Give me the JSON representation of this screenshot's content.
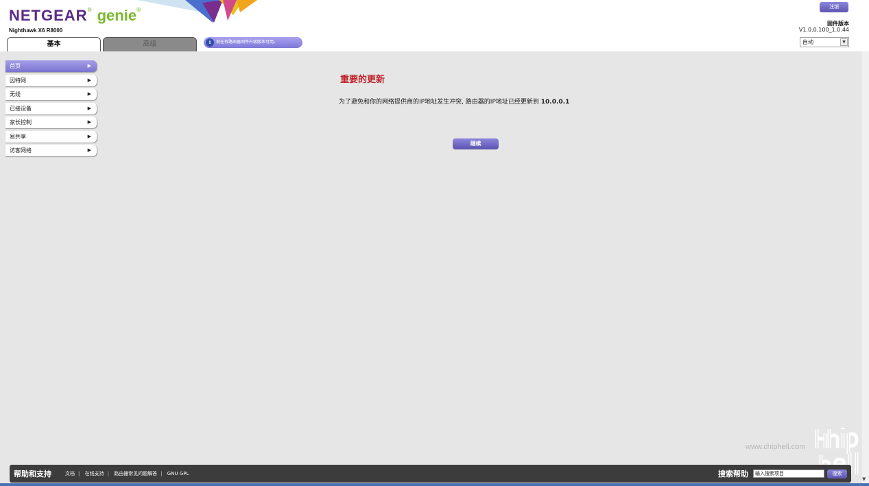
{
  "header": {
    "logo_netgear": "NETGEAR",
    "logo_genie": "genie",
    "model": "Nighthawk X6 R8000",
    "logout_label": "注销",
    "firmware_label": "固件版本",
    "firmware_version": "V1.0.0.100_1.0.44",
    "language_value": "自动",
    "info_message": "现在有路由器固件升级版本可用。",
    "brand_colors": {
      "purple": "#5b2a86",
      "green": "#7cb82f",
      "accent": "#7b74cf"
    }
  },
  "tabs": [
    {
      "label": "基本",
      "active": true
    },
    {
      "label": "高级",
      "active": false
    }
  ],
  "sidebar": {
    "items": [
      {
        "label": "首页",
        "active": true
      },
      {
        "label": "因特网",
        "active": false
      },
      {
        "label": "无线",
        "active": false
      },
      {
        "label": "已接设备",
        "active": false
      },
      {
        "label": "家长控制",
        "active": false
      },
      {
        "label": "易共享",
        "active": false
      },
      {
        "label": "访客网络",
        "active": false
      }
    ]
  },
  "main": {
    "title": "重要的更新",
    "message": "为了避免和你的网络提供商的IP地址发生冲突, 路由器的IP地址已经更新到",
    "new_ip": "10.0.0.1",
    "continue_label": "继续"
  },
  "footer": {
    "title": "帮助和支持",
    "links": [
      "文档",
      "在线支持",
      "路由器常见问题解答",
      "GNU GPL"
    ],
    "search_label": "搜索帮助",
    "search_value": "输入搜索项目",
    "search_button": "搜索"
  },
  "watermark": {
    "text": "www.chiphell.com"
  }
}
